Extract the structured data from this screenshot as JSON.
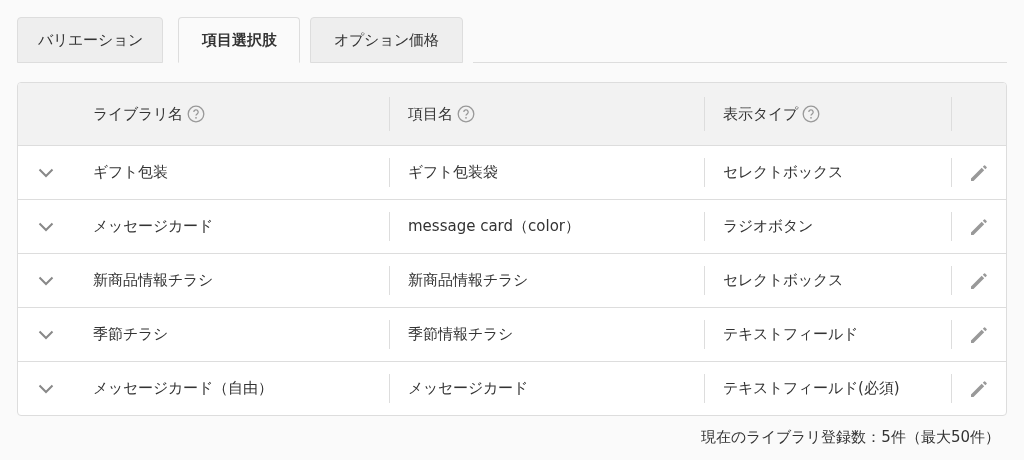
{
  "tabs": [
    {
      "label": "バリエーション",
      "selected": false
    },
    {
      "label": "項目選択肢",
      "selected": true
    },
    {
      "label": "オプション価格",
      "selected": false
    }
  ],
  "table": {
    "columns": [
      {
        "label": "ライブラリ名",
        "help": true
      },
      {
        "label": "項目名",
        "help": true
      },
      {
        "label": "表示タイプ",
        "help": true
      }
    ],
    "rows": [
      {
        "library_name": "ギフト包装",
        "item_name": "ギフト包装袋",
        "display_type": "セレクトボックス"
      },
      {
        "library_name": "メッセージカード",
        "item_name": "message card（color）",
        "display_type": "ラジオボタン"
      },
      {
        "library_name": "新商品情報チラシ",
        "item_name": "新商品情報チラシ",
        "display_type": "セレクトボックス"
      },
      {
        "library_name": "季節チラシ",
        "item_name": "季節情報チラシ",
        "display_type": "テキストフィールド"
      },
      {
        "library_name": "メッセージカード（自由）",
        "item_name": "メッセージカード",
        "display_type": "テキストフィールド(必須)"
      }
    ]
  },
  "footer": "現在のライブラリ登録数：5件（最大50件）"
}
